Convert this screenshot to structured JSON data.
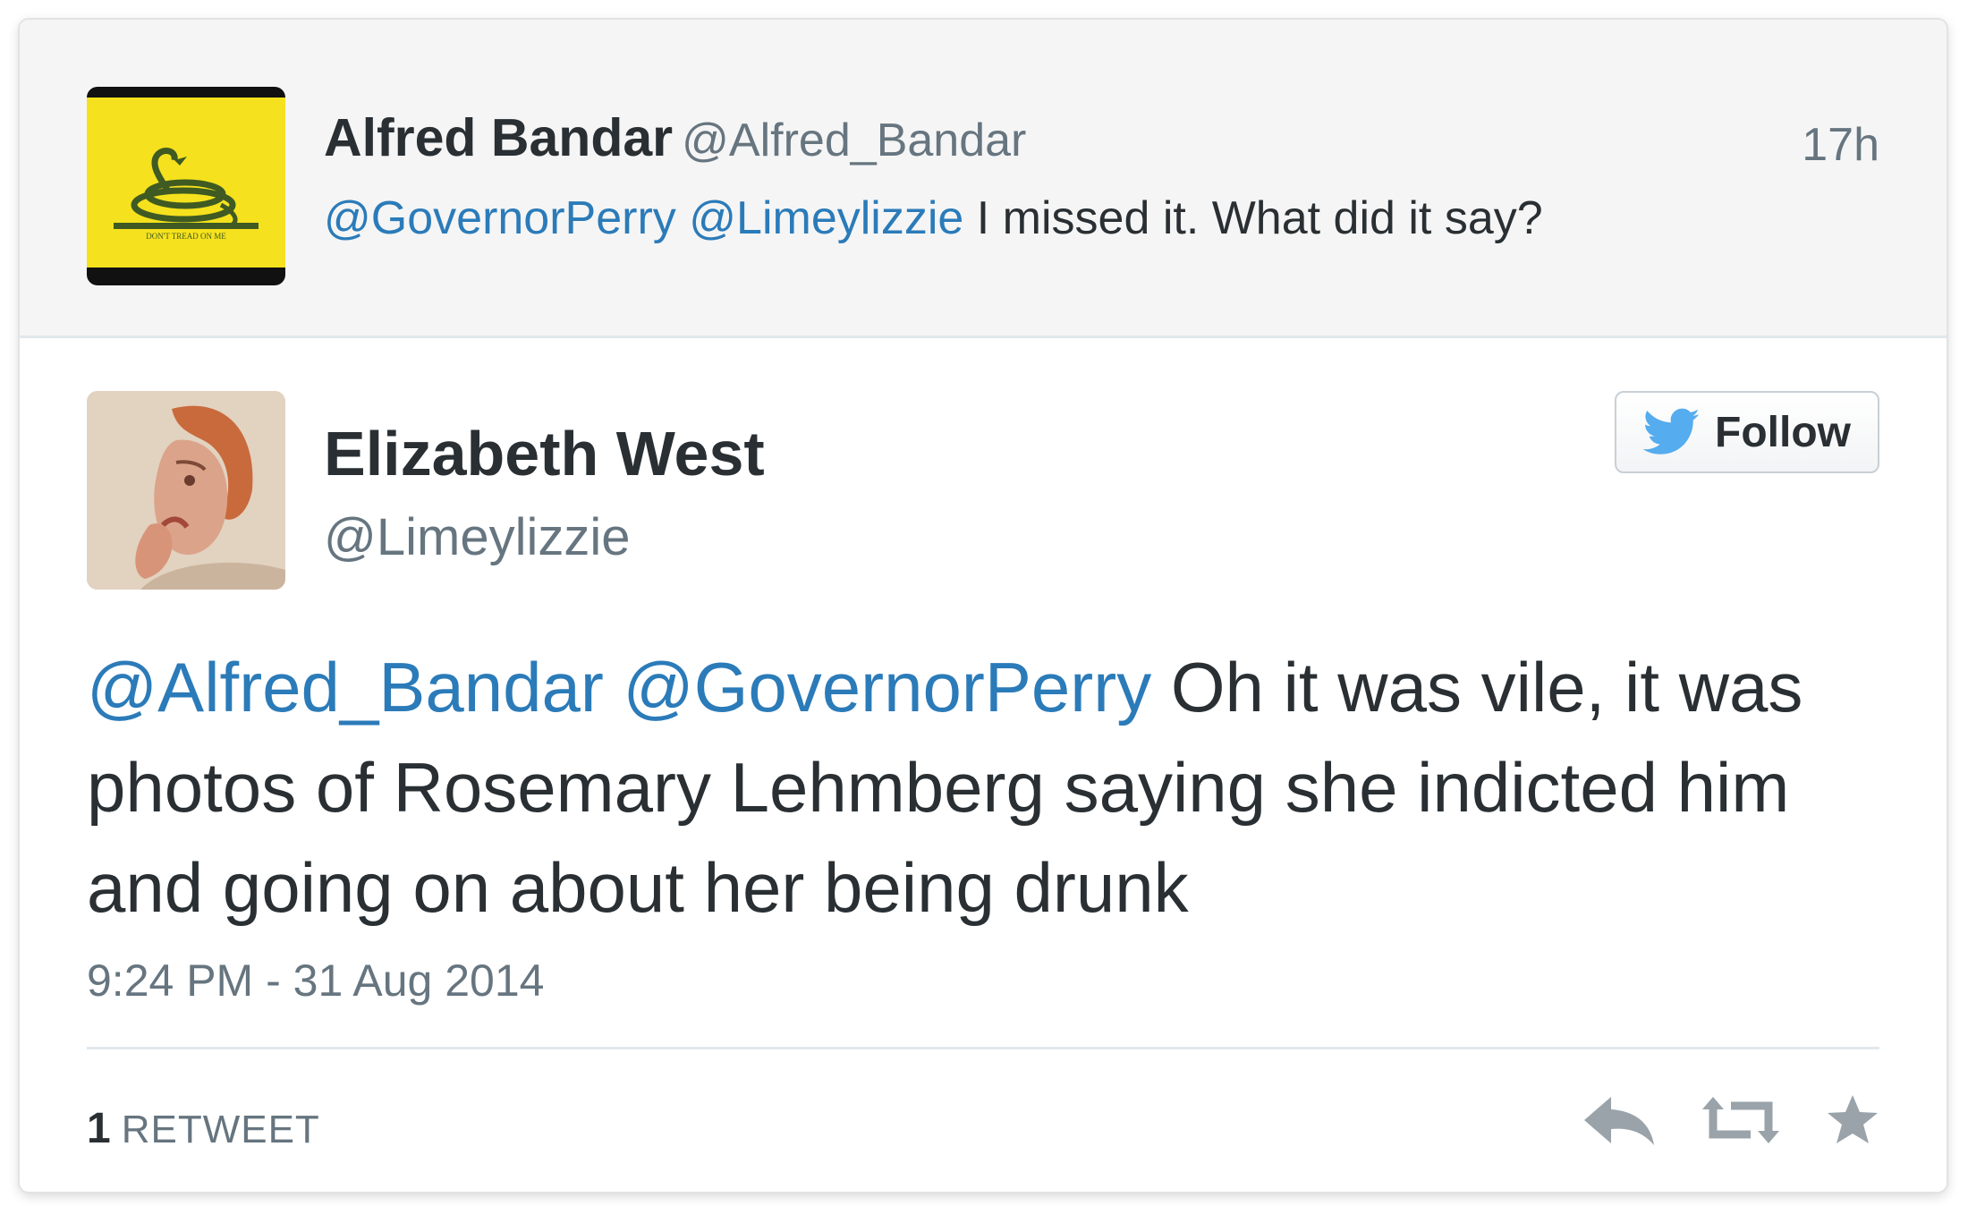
{
  "reply": {
    "name": "Alfred Bandar",
    "handle": "@Alfred_Bandar",
    "time": "17h",
    "mentions": [
      "@GovernorPerry",
      "@Limeylizzie"
    ],
    "text": "I missed it.  What did it say?",
    "avatar_logo_text": "DON'T TREAD ON ME"
  },
  "tweet": {
    "author_name": "Elizabeth West",
    "author_handle": "@Limeylizzie",
    "follow_label": "Follow",
    "mentions": [
      "@Alfred_Bandar",
      "@GovernorPerry"
    ],
    "text": "Oh it was vile, it was photos of Rosemary Lehmberg saying she indicted him and going on about her being drunk",
    "timestamp": "9:24 PM - 31 Aug 2014",
    "retweet_count": "1",
    "retweet_label": "RETWEET",
    "actions": [
      "reply-icon",
      "retweet-icon",
      "favorite-icon"
    ]
  },
  "colors": {
    "link": "#2b7bb9",
    "text": "#292f33",
    "muted": "#66757f",
    "twitter_blue": "#55acee",
    "reply_bg": "#f5f5f5",
    "gadsden_yellow": "#f5e11d"
  }
}
